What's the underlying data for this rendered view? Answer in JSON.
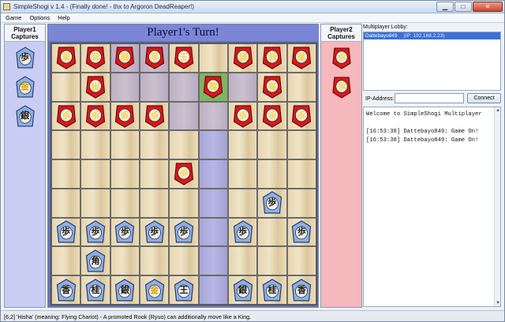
{
  "window": {
    "title": "SimpleShogi v 1.4 - (Finally done! - thx to Argoron DeadReaper!)",
    "minimize_icon": "minimize-icon",
    "maximize_icon": "maximize-icon",
    "close_icon": "close-icon"
  },
  "menu": {
    "items": [
      "Game",
      "Options",
      "Help"
    ]
  },
  "player1": {
    "header": "Player1\nCaptures",
    "captures": [
      "歩",
      "金",
      "銀"
    ]
  },
  "player2": {
    "header": "Player2\nCaptures",
    "captures": [
      "歩",
      "歩"
    ]
  },
  "board": {
    "banner": "Player1's Turn!",
    "colors": {
      "wood": "#e6d6b0",
      "purple_file": "#bdb0c2",
      "lavender": "#a8a6d8",
      "selected": "#7eb462",
      "red_piece": "#d81818",
      "blue_piece": "#8cb0e8"
    },
    "rows": [
      [
        "r:香",
        "r:桂",
        "r:銀",
        "r:金",
        "r:王",
        "",
        "r:銀",
        "r:桂",
        "r:香"
      ],
      [
        "",
        "r:飛",
        "",
        "",
        "",
        "g:龍",
        "",
        "r:角",
        ""
      ],
      [
        "r:歩",
        "r:歩",
        "r:歩",
        "r:歩",
        "",
        "",
        "r:歩",
        "r:歩",
        "r:歩"
      ],
      [
        "",
        "",
        "",
        "",
        "",
        "",
        "",
        "",
        ""
      ],
      [
        "",
        "",
        "",
        "",
        "r:歩",
        "",
        "",
        "",
        ""
      ],
      [
        "",
        "",
        "",
        "",
        "",
        "",
        "",
        "b:歩",
        ""
      ],
      [
        "b:歩",
        "b:歩",
        "b:歩",
        "b:歩",
        "b:歩",
        "",
        "b:歩",
        "",
        "b:歩"
      ],
      [
        "",
        "b:角",
        "",
        "",
        "",
        "",
        "",
        "",
        ""
      ],
      [
        "b:香",
        "b:桂",
        "b:銀",
        "b:金",
        "b:王",
        "",
        "b:銀",
        "b:桂",
        "b:香"
      ]
    ],
    "purple_cells": [
      [
        0,
        2
      ],
      [
        0,
        3
      ],
      [
        1,
        2
      ],
      [
        1,
        3
      ],
      [
        1,
        4
      ],
      [
        1,
        6
      ],
      [
        2,
        4
      ],
      [
        2,
        5
      ],
      [
        3,
        5
      ],
      [
        4,
        5
      ],
      [
        5,
        5
      ],
      [
        6,
        5
      ],
      [
        7,
        5
      ],
      [
        8,
        5
      ]
    ],
    "lav_cells": [
      [
        3,
        5
      ],
      [
        4,
        5
      ],
      [
        5,
        5
      ],
      [
        6,
        5
      ],
      [
        7,
        5
      ],
      [
        8,
        5
      ]
    ]
  },
  "lobby": {
    "label": "Multiplayer Lobby:",
    "entries": [
      {
        "name": "Dattebayo849",
        "ip": "(IP: 192.168.2.23)"
      }
    ]
  },
  "ip_row": {
    "label": "IP-Address:",
    "value": "",
    "connect_label": "Connect"
  },
  "chat": {
    "lines": [
      "Welcome to SimpleShogi Multiplayer",
      "",
      "[16:53:38] Dattebayo849: Game On!",
      "[16:53:38] Dattebayo849: Game On!"
    ]
  },
  "status": "[6,2] 'Hisha' (meaning: Flying Chariot) - A promoted Rook (Ryuo) can additionally move like a King."
}
